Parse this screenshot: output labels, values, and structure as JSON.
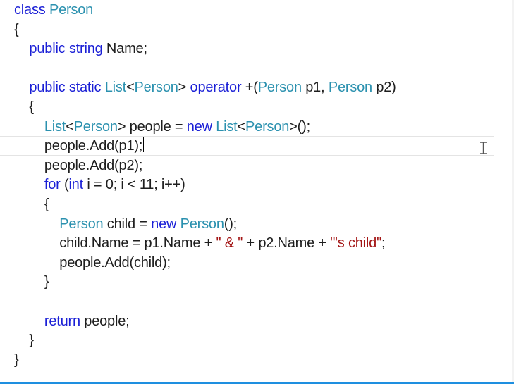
{
  "code": {
    "lines": [
      [
        {
          "t": "class ",
          "c": "kw"
        },
        {
          "t": "Person",
          "c": "ty"
        }
      ],
      [
        {
          "t": "{",
          "c": ""
        }
      ],
      [
        {
          "t": "    public string ",
          "c": "kw"
        },
        {
          "t": "Name;",
          "c": ""
        }
      ],
      [],
      [
        {
          "t": "    public static ",
          "c": "kw"
        },
        {
          "t": "List",
          "c": "ty"
        },
        {
          "t": "<",
          "c": ""
        },
        {
          "t": "Person",
          "c": "ty"
        },
        {
          "t": "> ",
          "c": ""
        },
        {
          "t": "operator ",
          "c": "kw"
        },
        {
          "t": "+(",
          "c": ""
        },
        {
          "t": "Person",
          "c": "ty"
        },
        {
          "t": " p1, ",
          "c": ""
        },
        {
          "t": "Person",
          "c": "ty"
        },
        {
          "t": " p2)",
          "c": ""
        }
      ],
      [
        {
          "t": "    {",
          "c": ""
        }
      ],
      [
        {
          "t": "        ",
          "c": ""
        },
        {
          "t": "List",
          "c": "ty"
        },
        {
          "t": "<",
          "c": ""
        },
        {
          "t": "Person",
          "c": "ty"
        },
        {
          "t": "> people = ",
          "c": ""
        },
        {
          "t": "new ",
          "c": "kw"
        },
        {
          "t": "List",
          "c": "ty"
        },
        {
          "t": "<",
          "c": ""
        },
        {
          "t": "Person",
          "c": "ty"
        },
        {
          "t": ">();",
          "c": ""
        }
      ],
      [
        {
          "t": "        people.Add(p1);",
          "c": ""
        }
      ],
      [
        {
          "t": "        people.Add(p2);",
          "c": ""
        }
      ],
      [
        {
          "t": "        ",
          "c": ""
        },
        {
          "t": "for ",
          "c": "kw"
        },
        {
          "t": "(",
          "c": ""
        },
        {
          "t": "int ",
          "c": "kw"
        },
        {
          "t": "i = 0; i < 11; i++)",
          "c": ""
        }
      ],
      [
        {
          "t": "        {",
          "c": ""
        }
      ],
      [
        {
          "t": "            ",
          "c": ""
        },
        {
          "t": "Person",
          "c": "ty"
        },
        {
          "t": " child = ",
          "c": ""
        },
        {
          "t": "new ",
          "c": "kw"
        },
        {
          "t": "Person",
          "c": "ty"
        },
        {
          "t": "();",
          "c": ""
        }
      ],
      [
        {
          "t": "            child.Name = p1.Name + ",
          "c": ""
        },
        {
          "t": "\" & \"",
          "c": "st"
        },
        {
          "t": " + p2.Name + ",
          "c": ""
        },
        {
          "t": "\"'s child\"",
          "c": "st"
        },
        {
          "t": ";",
          "c": ""
        }
      ],
      [
        {
          "t": "            people.Add(child);",
          "c": ""
        }
      ],
      [
        {
          "t": "        }",
          "c": ""
        }
      ],
      [],
      [
        {
          "t": "        ",
          "c": ""
        },
        {
          "t": "return ",
          "c": "kw"
        },
        {
          "t": "people;",
          "c": ""
        }
      ],
      [
        {
          "t": "    }",
          "c": ""
        }
      ],
      [
        {
          "t": "}",
          "c": ""
        }
      ]
    ],
    "caret_line": 7
  },
  "colors": {
    "keyword": "#1a1fd6",
    "type": "#2b91af",
    "string": "#a31515",
    "text": "#1e1e1e",
    "accent_bar": "#1e8fe0"
  },
  "icons": {
    "cursor": "ibeam-cursor-icon"
  }
}
